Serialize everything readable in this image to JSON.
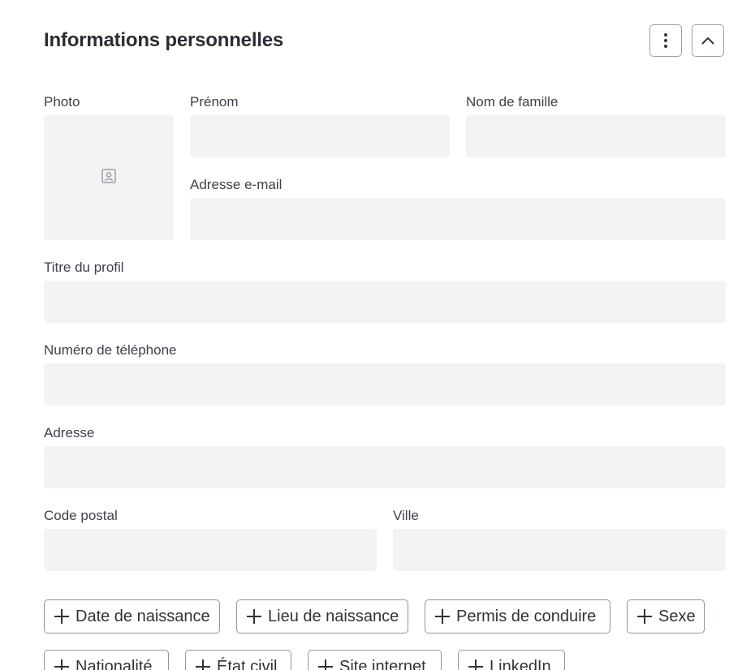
{
  "section": {
    "title": "Informations personnelles",
    "more_icon": "vertical-dots-icon",
    "collapse_icon": "chevron-up-icon"
  },
  "fields": {
    "photo": {
      "label": "Photo",
      "icon": "portrait-placeholder-icon"
    },
    "first_name": {
      "label": "Prénom",
      "value": ""
    },
    "last_name": {
      "label": "Nom de famille",
      "value": ""
    },
    "email": {
      "label": "Adresse e-mail",
      "value": ""
    },
    "profile_title": {
      "label": "Titre du profil",
      "value": ""
    },
    "phone": {
      "label": "Numéro de téléphone",
      "value": ""
    },
    "address": {
      "label": "Adresse",
      "value": ""
    },
    "postal_code": {
      "label": "Code postal",
      "value": ""
    },
    "city": {
      "label": "Ville",
      "value": ""
    }
  },
  "optional_fields": [
    "Date de naissance",
    "Lieu de naissance",
    "Permis de conduire",
    "Sexe",
    "Nationalité",
    "État civil",
    "Site internet",
    "LinkedIn"
  ],
  "colors": {
    "field_bg": "#f3f3f3",
    "border": "#8f959d",
    "text": "#2b2f36"
  }
}
